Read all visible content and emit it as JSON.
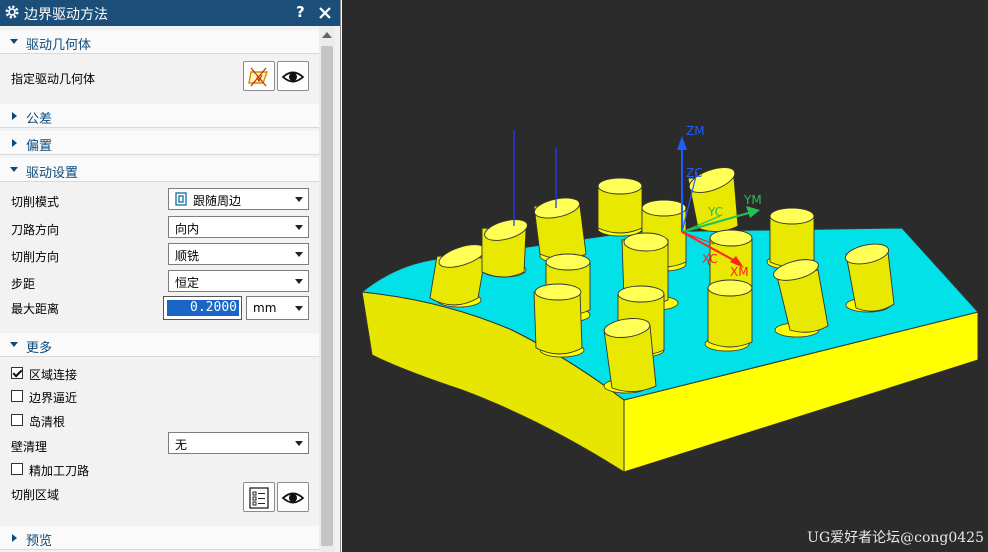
{
  "dialog": {
    "title": "边界驱动方法",
    "help_label": "?",
    "sections": {
      "drive_geometry": {
        "label": "驱动几何体",
        "expanded": true
      },
      "tolerance": {
        "label": "公差",
        "expanded": false
      },
      "offset": {
        "label": "偏置",
        "expanded": false
      },
      "drive_settings": {
        "label": "驱动设置",
        "expanded": true
      },
      "more": {
        "label": "更多",
        "expanded": true
      },
      "preview": {
        "label": "预览",
        "expanded": false
      }
    },
    "specify_drive_geometry_label": "指定驱动几何体",
    "cut_pattern": {
      "label": "切削模式",
      "value": "跟随周边"
    },
    "tool_path_direction": {
      "label": "刀路方向",
      "value": "向内"
    },
    "cut_direction": {
      "label": "切削方向",
      "value": "顺铣"
    },
    "stepover": {
      "label": "步距",
      "value": "恒定"
    },
    "max_distance": {
      "label": "最大距离",
      "value": "0.2000",
      "unit": "mm"
    },
    "region_connect": {
      "label": "区域连接",
      "checked": true
    },
    "boundary_approx": {
      "label": "边界逼近",
      "checked": false
    },
    "island_cleanup": {
      "label": "岛清根",
      "checked": false
    },
    "wall_cleanup": {
      "label": "壁清理",
      "value": "无"
    },
    "finish_passes": {
      "label": "精加工刀路",
      "checked": false
    },
    "cut_regions_label": "切削区域"
  },
  "viewport": {
    "axis_labels": {
      "zm": "ZM",
      "zc": "ZC",
      "yc": "YC",
      "ym": "YM",
      "xc": "XC",
      "xm": "XM"
    },
    "watermark": "UG爱好者论坛@cong0425",
    "colors": {
      "background": "#2b2b2b",
      "part_top": "#00e5e5",
      "part_side": "#ffff00",
      "axis_z": "#1e5cff",
      "axis_y": "#22c055",
      "axis_x": "#ff2222"
    }
  },
  "icons": [
    "gear-icon",
    "help-icon",
    "close-icon",
    "select-geometry-icon",
    "show-eye-icon",
    "follow-periphery-icon",
    "region-list-icon"
  ]
}
